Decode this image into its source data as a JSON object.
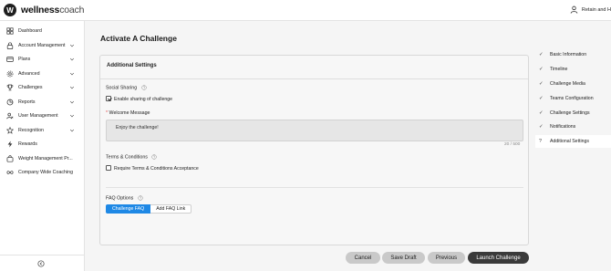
{
  "brand": {
    "mark": "W",
    "name_bold": "wellness",
    "name_light": "coach"
  },
  "user": {
    "name": "Retain and H"
  },
  "sidebar": {
    "items": [
      {
        "label": "Dashboard",
        "icon": "grid-icon",
        "has_chevron": false
      },
      {
        "label": "Account Management",
        "icon": "lock-icon",
        "has_chevron": true
      },
      {
        "label": "Plans",
        "icon": "card-icon",
        "has_chevron": true
      },
      {
        "label": "Advanced",
        "icon": "gear-icon",
        "has_chevron": true
      },
      {
        "label": "Challenges",
        "icon": "trophy-icon",
        "has_chevron": true
      },
      {
        "label": "Reports",
        "icon": "chart-icon",
        "has_chevron": true
      },
      {
        "label": "User Management",
        "icon": "users-icon",
        "has_chevron": true
      },
      {
        "label": "Recognition",
        "icon": "star-icon",
        "has_chevron": true
      },
      {
        "label": "Rewards",
        "icon": "bolt-icon",
        "has_chevron": false
      },
      {
        "label": "Weight Management Pr...",
        "icon": "bag-icon",
        "has_chevron": false
      },
      {
        "label": "Company Wide Coaching",
        "icon": "loop-icon",
        "has_chevron": false
      }
    ]
  },
  "main": {
    "title": "Activate A Challenge",
    "card": {
      "title": "Additional Settings",
      "social_sharing": {
        "label": "Social Sharing",
        "checkbox_label": "Enable sharing of challenge",
        "checked": true
      },
      "welcome": {
        "required_mark": "*",
        "label": "Welcome Message",
        "value": "Enjoy the challenge!",
        "counter": "20 / 500"
      },
      "terms": {
        "label": "Terms & Conditions",
        "checkbox_label": "Require Terms & Conditions Acceptance",
        "checked": false
      },
      "faq": {
        "label": "FAQ Options",
        "options": [
          "Challenge FAQ",
          "Add FAQ Link"
        ],
        "selected": "Challenge FAQ"
      }
    }
  },
  "footer": {
    "cancel": "Cancel",
    "save_draft": "Save Draft",
    "previous": "Previous",
    "launch": "Launch Challenge"
  },
  "steps": [
    {
      "label": "Basic Information",
      "mark": "✓"
    },
    {
      "label": "Timeline",
      "mark": "✓"
    },
    {
      "label": "Challenge Media",
      "mark": "✓"
    },
    {
      "label": "Teams Configuration",
      "mark": "✓"
    },
    {
      "label": "Challenge Settings",
      "mark": "✓"
    },
    {
      "label": "Notifications",
      "mark": "✓"
    },
    {
      "label": "Additional Settings",
      "mark": "?"
    }
  ],
  "colors": {
    "accent": "#1e88e5",
    "primary_button": "#3a3a3a",
    "secondary_button": "#c9c9c9"
  }
}
